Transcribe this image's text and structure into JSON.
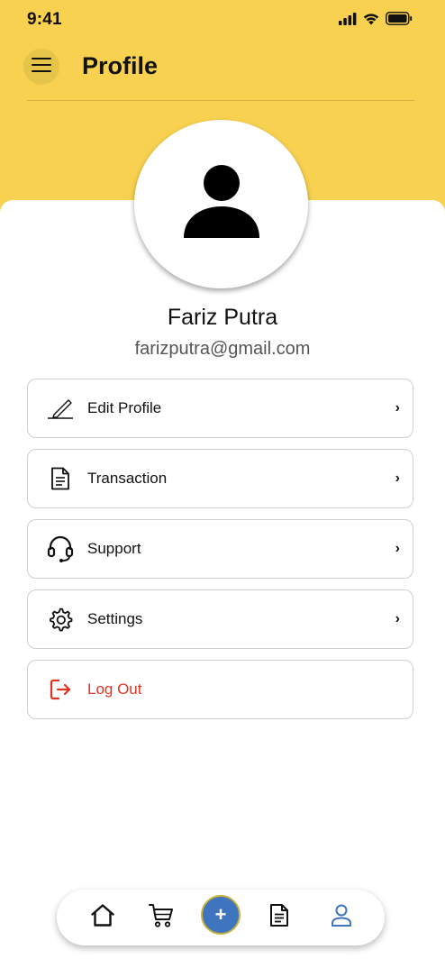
{
  "status_bar": {
    "time": "9:41",
    "icons": [
      "cellular-signal-icon",
      "wifi-icon",
      "battery-icon"
    ]
  },
  "header": {
    "title": "Profile",
    "menu_icon": "hamburger-menu-icon",
    "background_color": "#F7D14F"
  },
  "profile": {
    "avatar_icon": "user-avatar-icon",
    "name": "Fariz Putra",
    "email": "farizputra@gmail.com"
  },
  "menu": {
    "items": [
      {
        "label": "Edit Profile",
        "icon": "pencil-icon",
        "chevron": "›"
      },
      {
        "label": "Transaction",
        "icon": "document-icon",
        "chevron": "›"
      },
      {
        "label": "Support",
        "icon": "headset-icon",
        "chevron": "›"
      },
      {
        "label": "Settings",
        "icon": "gear-icon",
        "chevron": "›"
      },
      {
        "label": "Log Out",
        "icon": "logout-icon",
        "color": "#E03323"
      }
    ]
  },
  "bottom_nav": {
    "items": [
      {
        "icon": "home-icon"
      },
      {
        "icon": "cart-icon"
      },
      {
        "icon": "plus-icon",
        "label": "+"
      },
      {
        "icon": "document-icon"
      },
      {
        "icon": "user-icon",
        "active": true,
        "active_color": "#3F74BE"
      }
    ]
  }
}
